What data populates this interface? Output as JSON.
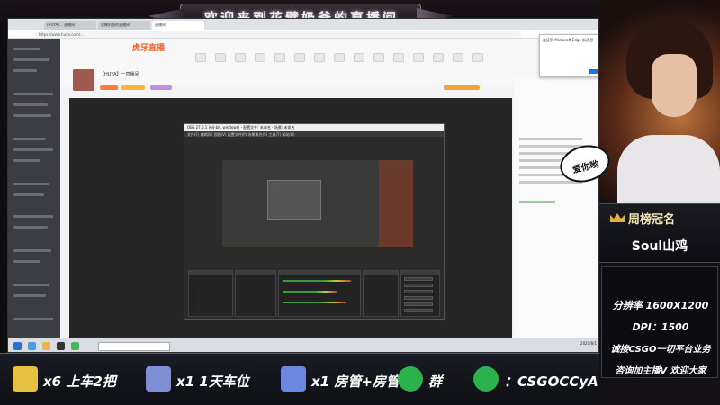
{
  "banner": {
    "title": "欢迎来到花臂奶爸的直播间"
  },
  "browser": {
    "tabs": [
      "[HUYA]... 直播间",
      "花臂奶爸的直播间",
      "直播间"
    ],
    "address": "https://www.huya.com/..."
  },
  "site": {
    "logo": "虎牙直播",
    "room_title": "【HUYA】一直播间",
    "popup_text": "连接到 Microsoft Edge 新消息"
  },
  "obs": {
    "title": "OBS 27.0.1 (64-bit, windows) - 配置文件: 未命名 - 场景: 未命名",
    "menu": "文件(F)  编辑(E)  视图(V)  配置文件(P)  场景集合(S)  工具(T)  帮助(H)",
    "dock_labels": [
      "场景",
      "来源",
      "混音器",
      "转场",
      "控件"
    ],
    "controls": [
      "开始推流",
      "开始录制",
      "启动虚拟摄像机",
      "工作室模式",
      "设置",
      "退出"
    ]
  },
  "taskbar": {
    "clock": "2021/8/1"
  },
  "right_panel": {
    "bubble": "爱你哟",
    "crown_title": "周榜冠名",
    "crown_name": "Soul山鸡",
    "info": [
      "分辨率 1600X1200",
      "DPI：1500",
      "诚接CSGO一切平台业务",
      "咨询加主播V  欢迎大家"
    ]
  },
  "bottom_bar": [
    {
      "icon": "ticket-icon",
      "label": "x6 上车2把",
      "color": "#e7c043"
    },
    {
      "icon": "plane-icon",
      "label": "x1 1天车位",
      "color": "#7f8fd6"
    },
    {
      "icon": "rocket-icon",
      "label": "x1 房管+房管",
      "color": "#6c87e0"
    },
    {
      "icon": "wechat-icon",
      "label": "群",
      "color": "#2bb24c"
    },
    {
      "icon": "wechat-icon",
      "label": "：CSGOCCyA",
      "color": "#2bb24c"
    }
  ]
}
